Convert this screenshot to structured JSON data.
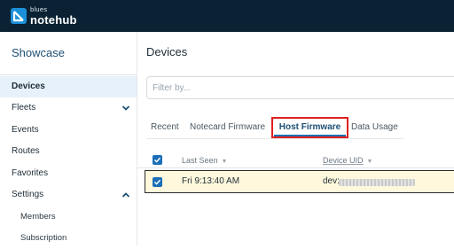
{
  "brand": {
    "small": "blues",
    "big": "notehub"
  },
  "sidebar": {
    "title": "Showcase",
    "items": [
      {
        "label": "Devices",
        "active": true
      },
      {
        "label": "Fleets",
        "chevron": "down"
      },
      {
        "label": "Events"
      },
      {
        "label": "Routes"
      },
      {
        "label": "Favorites"
      },
      {
        "label": "Settings",
        "chevron": "up"
      },
      {
        "label": "Members",
        "sub": true
      },
      {
        "label": "Subscription",
        "sub": true
      }
    ]
  },
  "main": {
    "title": "Devices",
    "filter_placeholder": "Filter by...",
    "tabs": [
      "Recent",
      "Notecard Firmware",
      "Host Firmware",
      "Data Usage"
    ],
    "active_tab": "Host Firmware"
  },
  "table": {
    "columns": [
      "Last Seen",
      "Device UID"
    ],
    "rows": [
      {
        "last_seen": "Fri 9:13:40 AM",
        "device_uid": "dev:"
      }
    ]
  },
  "colors": {
    "topbar": "#0a2233",
    "accent": "#1d6fb0",
    "highlight_box": "#e02020",
    "row_bg": "#fff8dc"
  }
}
